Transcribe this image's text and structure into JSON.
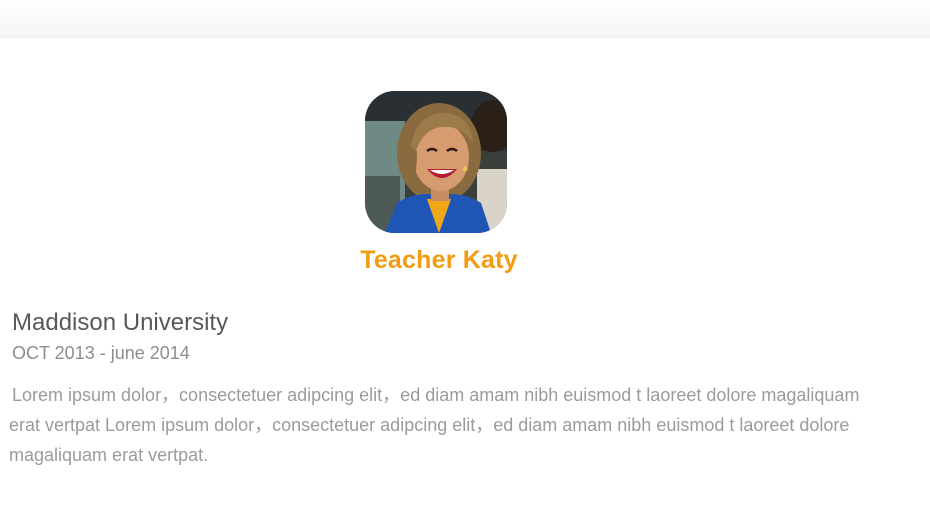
{
  "profile": {
    "name": "Teacher Katy",
    "avatar_icon": "teacher-portrait",
    "accent_color": "#f39c12"
  },
  "education": {
    "institution": "Maddison University",
    "dates": "OCT 2013 - june 2014",
    "description": "Lorem ipsum dolor，consectetuer adipcing elit，ed diam amam nibh euismod t laoreet dolore magaliquam erat vertpat Lorem ipsum dolor，consectetuer adipcing elit，ed diam amam nibh euismod t laoreet dolore magaliquam erat vertpat."
  }
}
